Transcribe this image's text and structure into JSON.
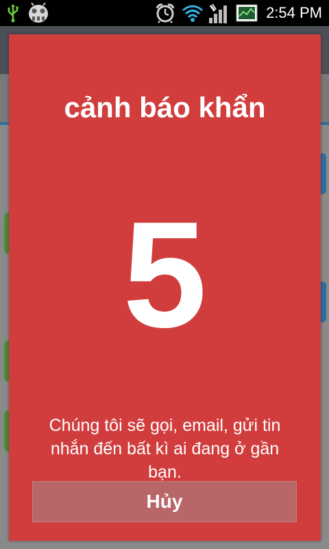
{
  "status_bar": {
    "time": "2:54 PM",
    "icons": [
      "usb-icon",
      "bug-icon",
      "alarm-icon",
      "wifi-icon",
      "signal-icon",
      "screenshot-icon"
    ]
  },
  "dialog": {
    "title": "cảnh báo khẩn",
    "countdown": "5",
    "message": "Chúng tôi sẽ gọi, email, gửi tin nhắn đến bất kì ai đang ở gần bạn.",
    "cancel_label": "Hủy"
  },
  "colors": {
    "dialog_background": "#d13d3d",
    "cancel_button_background": "#b86667",
    "text": "#ffffff"
  }
}
